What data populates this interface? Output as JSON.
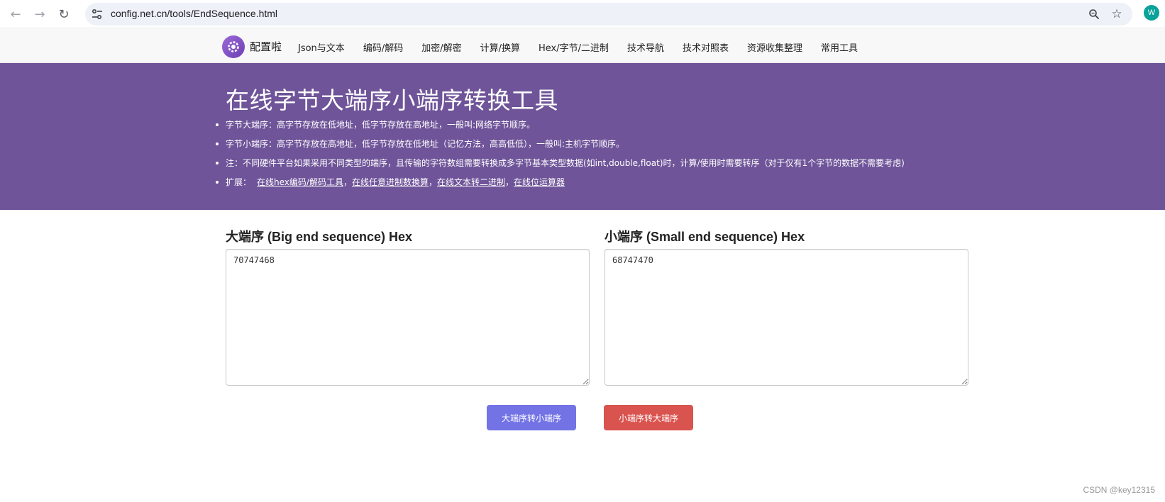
{
  "browser": {
    "url": "config.net.cn/tools/EndSequence.html",
    "profile_initial": "W"
  },
  "site": {
    "brand": "配置啦",
    "menu": [
      "Json与文本",
      "编码/解码",
      "加密/解密",
      "计算/换算",
      "Hex/字节/二进制",
      "技术导航",
      "技术对照表",
      "资源收集整理",
      "常用工具"
    ]
  },
  "banner": {
    "title": "在线字节大端序小端序转换工具",
    "items": [
      "字节大端序：高字节存放在低地址，低字节存放在高地址，一般叫:网络字节顺序。",
      "字节小端序：高字节存放在高地址，低字节存放在低地址（记忆方法，高高低低），一般叫:主机字节顺序。",
      "注：不同硬件平台如果采用不同类型的端序，且传输的字符数组需要转换成多字节基本类型数据(如int,double,float)时，计算/使用时需要转序（对于仅有1个字节的数据不需要考虑)"
    ],
    "ext_label": "扩展：",
    "ext_links": [
      "在线hex编码/解码工具",
      "在线任意进制数换算",
      "在线文本转二进制",
      "在线位运算器"
    ],
    "ext_sep": "，"
  },
  "big": {
    "label": "大端序 (Big end sequence) Hex",
    "value": "70747468"
  },
  "small": {
    "label": "小端序 (Small end sequence) Hex",
    "value": "68747470"
  },
  "buttons": {
    "big_to_small": "大端序转小端序",
    "small_to_big": "小端序转大端序"
  },
  "watermark": "CSDN @key12315",
  "colors": {
    "banner": "#6f5499",
    "blue_button": "#7373e6",
    "red_button": "#d9534f",
    "profile": "#0aa29a"
  }
}
